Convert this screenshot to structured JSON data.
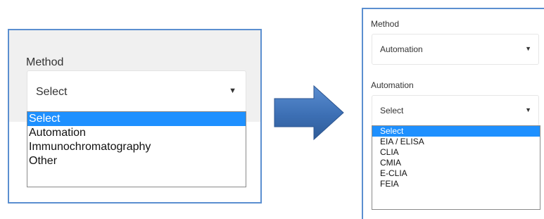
{
  "left": {
    "method_label": "Method",
    "select_value": "Select",
    "arrow_glyph": "▼",
    "options": [
      "Select",
      "Automation",
      "Immunochromatography",
      "Other"
    ],
    "selected_index": 0
  },
  "right": {
    "method_label": "Method",
    "method_value": "Automation",
    "automation_label": "Automation",
    "automation_value": "Select",
    "arrow_glyph": "▼",
    "options": [
      "Select",
      "EIA / ELISA",
      "CLIA",
      "CMIA",
      "E-CLIA",
      "FEIA"
    ],
    "selected_index": 0
  },
  "colors": {
    "panel_border": "#5b8fd0",
    "highlight": "#1e90ff",
    "arrow_fill": "#3c6fb4"
  },
  "icons": {
    "transition_arrow": "right-arrow-icon",
    "dropdown_caret": "triangle-down-icon"
  }
}
